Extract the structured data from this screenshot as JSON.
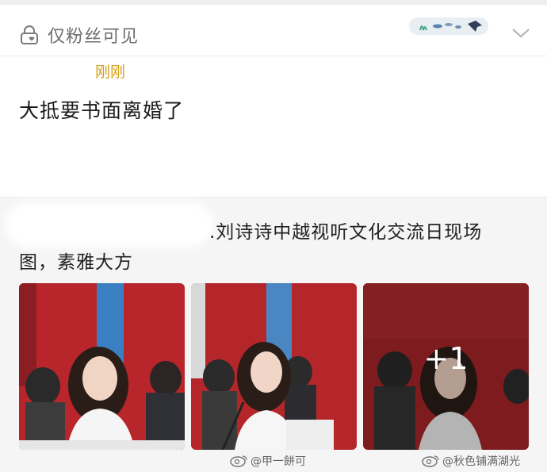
{
  "header": {
    "visibility_label": "仅粉丝可见",
    "visibility_icon": "lock-heart-icon",
    "expand_icon": "chevron-down-icon"
  },
  "post": {
    "timestamp": "刚刚",
    "text": "大抵要书面离婚了"
  },
  "repost": {
    "text_line1": ".刘诗诗中越视听文化交流日现场",
    "text_line2": "图，素雅大方",
    "images": [
      {
        "icon": "photo-woman-seated-icon"
      },
      {
        "icon": "photo-woman-speaking-icon"
      },
      {
        "icon": "photo-woman-seated-icon",
        "more_count": "+1"
      }
    ]
  },
  "watermarks": [
    {
      "text": "@甲一餅可",
      "icon": "weibo-icon"
    },
    {
      "text": "@秋色铺满湖光",
      "icon": "weibo-icon"
    }
  ],
  "colors": {
    "timestamp": "#d4a017",
    "photo_background": "#b8262c",
    "accent_blue": "#3a7fc1"
  }
}
